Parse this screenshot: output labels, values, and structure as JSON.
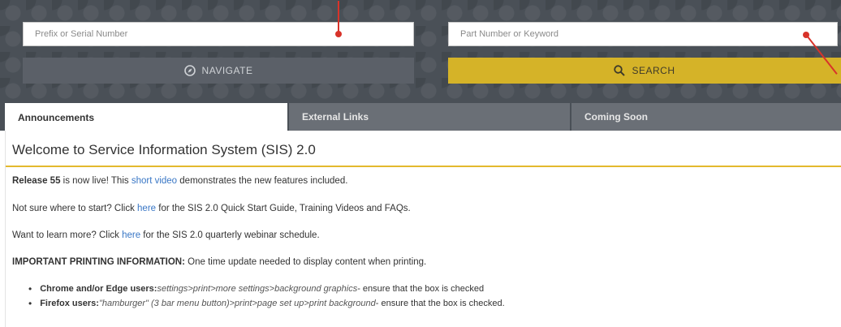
{
  "search_area": {
    "prefix_placeholder": "Prefix or Serial Number",
    "part_placeholder": "Part Number or Keyword",
    "navigate_label": "NAVIGATE",
    "search_label": "SEARCH"
  },
  "tabs": [
    {
      "label": "Announcements",
      "active": true
    },
    {
      "label": "External Links",
      "active": false
    },
    {
      "label": "Coming Soon",
      "active": false
    }
  ],
  "announcement": {
    "title": "Welcome to Service Information System (SIS) 2.0",
    "release_bold": "Release 55",
    "release_text_a": " is now live! This ",
    "release_link": "short video",
    "release_text_b": " demonstrates the new features included.",
    "start_text_a": "Not sure where to start? Click ",
    "start_link": "here",
    "start_text_b": " for the SIS 2.0 Quick Start Guide, Training Videos and FAQs.",
    "learn_text_a": "Want to learn more? Click ",
    "learn_link": "here",
    "learn_text_b": " for the SIS 2.0 quarterly webinar schedule.",
    "printing_bold": "IMPORTANT PRINTING INFORMATION:",
    "printing_text": " One time update needed to display content when printing.",
    "bullets": [
      {
        "bold": "Chrome and/or Edge users:",
        "italic": " settings>print>more settings>background graphics",
        "rest": " - ensure that the box is checked"
      },
      {
        "bold": "Firefox users:",
        "italic": " \"hamburger\" (3 bar menu button)>print>page set up>print background",
        "rest": " - ensure that the box is checked."
      }
    ]
  },
  "colors": {
    "header_bg": "#4a5057",
    "search_button": "#d5b328",
    "navigate_button": "#5b6068",
    "link": "#3876c5",
    "accent_rule": "#e3b92e",
    "marker": "#d8332a"
  },
  "icons": {
    "navigate": "compass-icon",
    "search": "magnifier-icon"
  }
}
